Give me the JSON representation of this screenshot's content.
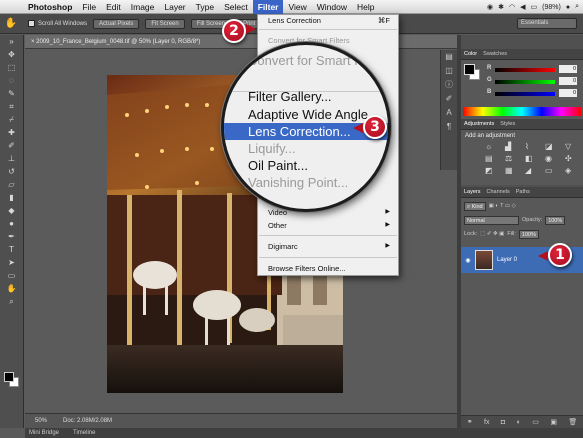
{
  "menubar": {
    "app_name": "Photoshop",
    "items": [
      "File",
      "Edit",
      "Image",
      "Layer",
      "Type",
      "Select",
      "Filter",
      "View",
      "Window",
      "Help"
    ],
    "active_item": "Filter",
    "battery": "(98%)",
    "colors": {
      "active": "#3b64c8"
    }
  },
  "options_bar": {
    "scroll_all_windows": "Scroll All Windows",
    "buttons": [
      "Actual Pixels",
      "Fit Screen",
      "Fill Screen",
      "Print Size"
    ],
    "workspace": "Essentials"
  },
  "document": {
    "tab_title": "2009_10_France_Belgium_0048.tif @ 50% (Layer 0, RGB/8*)",
    "zoom": "50%",
    "doc_size": "Doc: 2.08M/2.08M"
  },
  "bottom_tabs": [
    "Mini Bridge",
    "Timeline"
  ],
  "filter_menu": {
    "items": [
      {
        "label": "Lens Correction",
        "shortcut": "⌘F",
        "dim": false
      },
      {
        "label": "Convert for Smart Filters",
        "dim": true
      },
      {
        "label": "Video",
        "arrow": true
      },
      {
        "label": "Other",
        "arrow": true
      },
      {
        "label": "Digimarc",
        "arrow": true
      },
      {
        "label": "Browse Filters Online...",
        "dim": false
      }
    ]
  },
  "magnifier": {
    "top_text": "Convert for Smart Fi",
    "items": [
      "Filter Gallery...",
      "Adaptive Wide Angle...",
      "Lens Correction...",
      "Liquify...",
      "Oil Paint...",
      "Vanishing Point..."
    ],
    "highlighted": "Lens Correction...",
    "dim_items": [
      "Liquify...",
      "Vanishing Point..."
    ]
  },
  "color_panel": {
    "tabs": [
      "Color",
      "Swatches"
    ],
    "channels": [
      {
        "label": "R",
        "value": "0"
      },
      {
        "label": "G",
        "value": "0"
      },
      {
        "label": "B",
        "value": "0"
      }
    ]
  },
  "adjustments_panel": {
    "tabs": [
      "Adjustments",
      "Styles"
    ],
    "hint": "Add an adjustment"
  },
  "layers_panel": {
    "tabs": [
      "Layers",
      "Channels",
      "Paths"
    ],
    "kind": "Kind",
    "blend_mode": "Normal",
    "opacity_label": "Opacity:",
    "opacity": "100%",
    "lock_label": "Lock:",
    "fill_label": "Fill:",
    "fill": "100%",
    "layer_name": "Layer 0"
  },
  "callouts": [
    "1",
    "2",
    "3"
  ]
}
